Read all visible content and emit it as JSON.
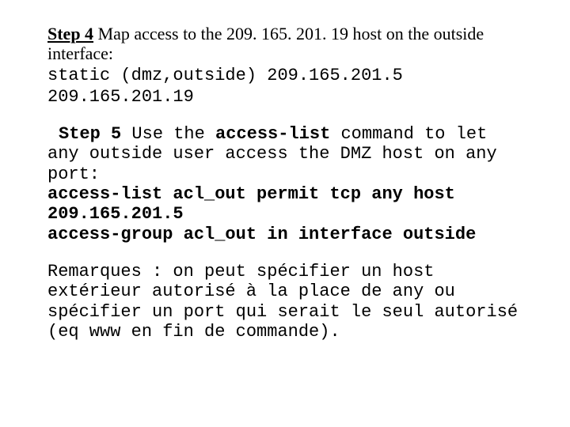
{
  "step4": {
    "label_prefix": "Step 4",
    "label_rest": " Map access to the 209. 165. 201. 19 host on the outside interface:",
    "cmd1": "static (dmz,outside) 209.165.201.5 209.165.201.19"
  },
  "step5": {
    "label_prefix": "Step 5",
    "use_the": " Use the ",
    "cmdname": "access-list",
    "rest": " command to let any outside user access the DMZ host on any port:",
    "cmd1": "access-list acl_out permit tcp any host 209.165.201.5",
    "cmd2": "access-group acl_out in interface outside"
  },
  "remarks": "Remarques : on peut spécifier un host extérieur autorisé à la place de any ou spécifier un port qui serait le seul autorisé (eq www en fin de commande)."
}
